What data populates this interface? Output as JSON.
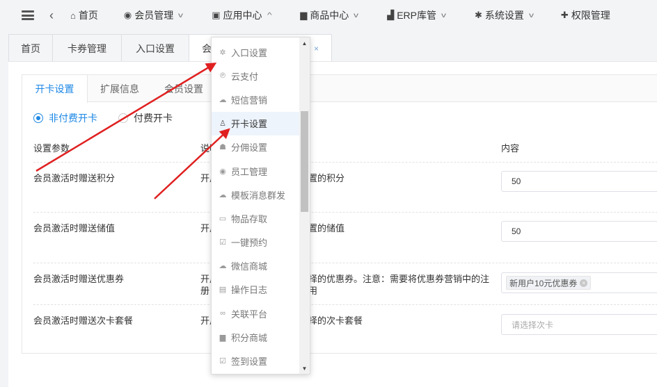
{
  "topnav": {
    "items": [
      {
        "icon": "home-icon",
        "glyph": "⌂",
        "label": "首页",
        "chevron": false
      },
      {
        "icon": "user-circle-icon",
        "glyph": "◉",
        "label": "会员管理",
        "chevron": true
      },
      {
        "icon": "rss-icon",
        "glyph": "▣",
        "label": "应用中心",
        "chevron": true
      },
      {
        "icon": "shopping-bag-icon",
        "glyph": "▆",
        "label": "商品中心",
        "chevron": true
      },
      {
        "icon": "sitemap-icon",
        "glyph": "▟",
        "label": "ERP库管",
        "chevron": true
      },
      {
        "icon": "gear-icon",
        "glyph": "✱",
        "label": "系统设置",
        "chevron": true
      },
      {
        "icon": "puzzle-icon",
        "glyph": "✚",
        "label": "权限管理",
        "chevron": false
      }
    ]
  },
  "tabs": {
    "items": [
      "首页",
      "卡券管理",
      "入口设置",
      "会"
    ],
    "close": "×"
  },
  "subtabs": [
    "开卡设置",
    "扩展信息",
    "会员设置"
  ],
  "radios": {
    "free": "非付费开卡",
    "paid": "付费开卡"
  },
  "table": {
    "headers": {
      "param": "设置参数",
      "desc": "说明",
      "content": "内容"
    },
    "rows": [
      {
        "param": "会员激活时赠送积分",
        "desc_left": "开启",
        "desc_right": "置的积分",
        "value": "50"
      },
      {
        "param": "会员激活时赠送储值",
        "desc_left": "开启",
        "desc_right": "置的储值",
        "value": "50"
      },
      {
        "param": "会员激活时赠送优惠券",
        "desc_left": "开启",
        "desc_left2": "册",
        "desc_right": "择的优惠券。注意：需要将优惠券营销中的注",
        "desc_right2": "用",
        "chip": "新用户10元优惠券"
      },
      {
        "param": "会员激活时赠送次卡套餐",
        "desc_left": "开启",
        "desc_right": "择的次卡套餐",
        "placeholder": "请选择次卡"
      }
    ]
  },
  "dropdown": {
    "items": [
      {
        "icon": "gear-icon",
        "glyph": "✲",
        "label": "入口设置"
      },
      {
        "icon": "paypal-icon",
        "glyph": "℗",
        "label": "云支付"
      },
      {
        "icon": "comment-icon",
        "glyph": "☁",
        "label": "短信营销"
      },
      {
        "icon": "user-icon",
        "glyph": "♙",
        "label": "开卡设置",
        "active": true
      },
      {
        "icon": "users-icon",
        "glyph": "☗",
        "label": "分佣设置"
      },
      {
        "icon": "user-circle-icon",
        "glyph": "◉",
        "label": "员工管理"
      },
      {
        "icon": "comments-icon",
        "glyph": "☁",
        "label": "模板消息群发"
      },
      {
        "icon": "hdd-icon",
        "glyph": "▭",
        "label": "物品存取"
      },
      {
        "icon": "calendar-check-icon",
        "glyph": "☑",
        "label": "一键预约"
      },
      {
        "icon": "wechat-icon",
        "glyph": "☁",
        "label": "微信商城"
      },
      {
        "icon": "list-alt-icon",
        "glyph": "▤",
        "label": "操作日志"
      },
      {
        "icon": "link-icon",
        "glyph": "∞",
        "label": "关联平台"
      },
      {
        "icon": "shopping-bag-icon",
        "glyph": "▆",
        "label": "积分商城"
      },
      {
        "icon": "calendar-check-icon",
        "glyph": "☑",
        "label": "签到设置"
      }
    ]
  },
  "colors": {
    "accent": "#1e88e5",
    "annotation": "#e02020"
  }
}
